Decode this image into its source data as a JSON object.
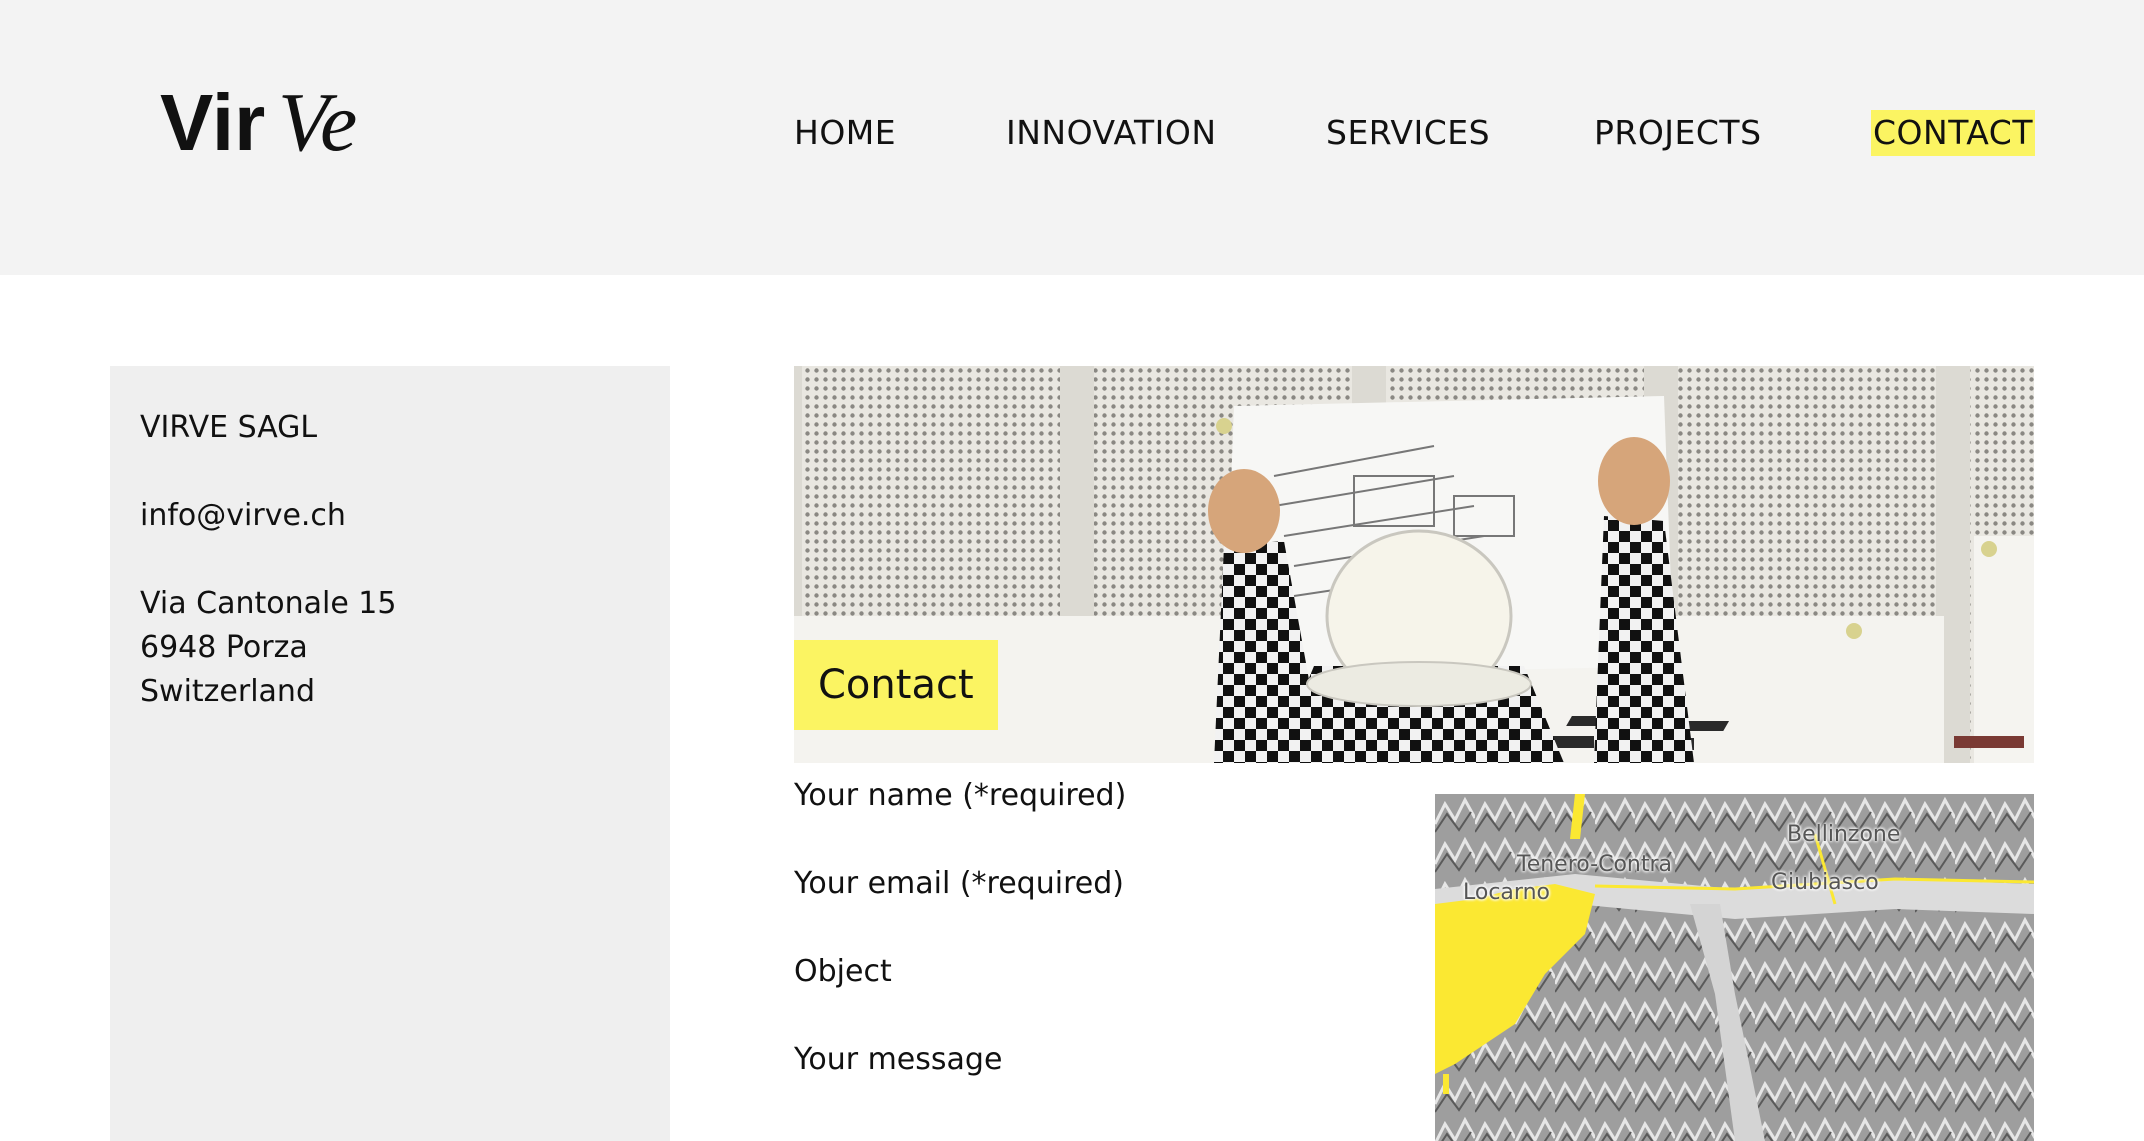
{
  "header": {
    "logo_text": "VirVe",
    "nav": [
      {
        "label": "HOME"
      },
      {
        "label": "INNOVATION"
      },
      {
        "label": "SERVICES"
      },
      {
        "label": "PROJECTS"
      },
      {
        "label": "CONTACT",
        "active": true
      }
    ]
  },
  "sidebar": {
    "company": "VIRVE SAGL",
    "email": "info@virve.ch",
    "address_line1": "Via Cantonale 15",
    "address_line2": "6948 Porza",
    "address_line3": "Switzerland"
  },
  "hero": {
    "badge": "Contact"
  },
  "form": {
    "name_label": "Your name (*required)",
    "email_label": "Your email (*required)",
    "object_label": "Object",
    "message_label": "Your message"
  },
  "map": {
    "places": [
      "Bellinzone",
      "Tenero-Contra",
      "Giubiasco",
      "Locarno"
    ]
  },
  "colors": {
    "accent": "#fbf462",
    "header_bg": "#f3f3f3",
    "sidebar_bg": "#efefef"
  }
}
